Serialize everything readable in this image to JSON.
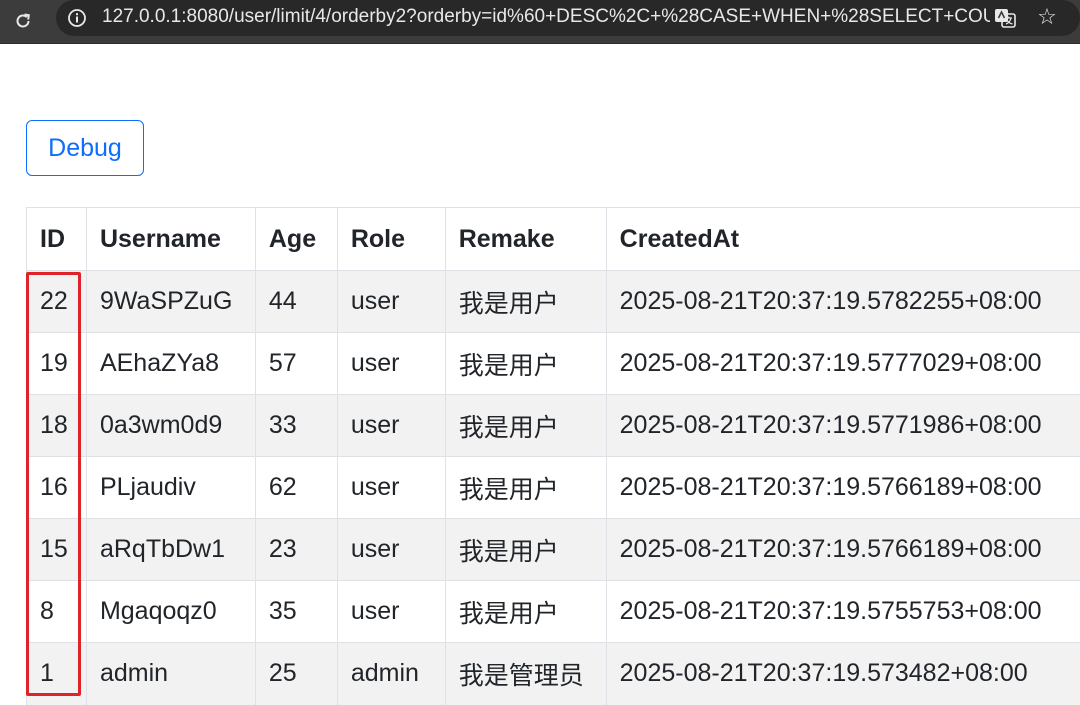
{
  "browser": {
    "url": "127.0.0.1:8080/user/limit/4/orderby2?orderby=id%60+DESC%2C+%28CASE+WHEN+%28SELECT+COUN..."
  },
  "debug_button": {
    "label": "Debug"
  },
  "table": {
    "headers": [
      "ID",
      "Username",
      "Age",
      "Role",
      "Remake",
      "CreatedAt"
    ],
    "rows": [
      [
        "22",
        "9WaSPZuG",
        "44",
        "user",
        "我是用户",
        "2025-08-21T20:37:19.5782255+08:00"
      ],
      [
        "19",
        "AEhaZYa8",
        "57",
        "user",
        "我是用户",
        "2025-08-21T20:37:19.5777029+08:00"
      ],
      [
        "18",
        "0a3wm0d9",
        "33",
        "user",
        "我是用户",
        "2025-08-21T20:37:19.5771986+08:00"
      ],
      [
        "16",
        "PLjaudiv",
        "62",
        "user",
        "我是用户",
        "2025-08-21T20:37:19.5766189+08:00"
      ],
      [
        "15",
        "aRqTbDw1",
        "23",
        "user",
        "我是用户",
        "2025-08-21T20:37:19.5766189+08:00"
      ],
      [
        "8",
        "Mgaqoqz0",
        "35",
        "user",
        "我是用户",
        "2025-08-21T20:37:19.5755753+08:00"
      ],
      [
        "1",
        "admin",
        "25",
        "admin",
        "我是管理员",
        "2025-08-21T20:37:19.573482+08:00"
      ]
    ]
  },
  "colors": {
    "accent": "#0d6efd",
    "highlight": "#e0222b",
    "stripe": "#f2f2f2"
  },
  "icons": [
    "reload-icon",
    "info-icon",
    "translate-icon",
    "star-icon"
  ]
}
